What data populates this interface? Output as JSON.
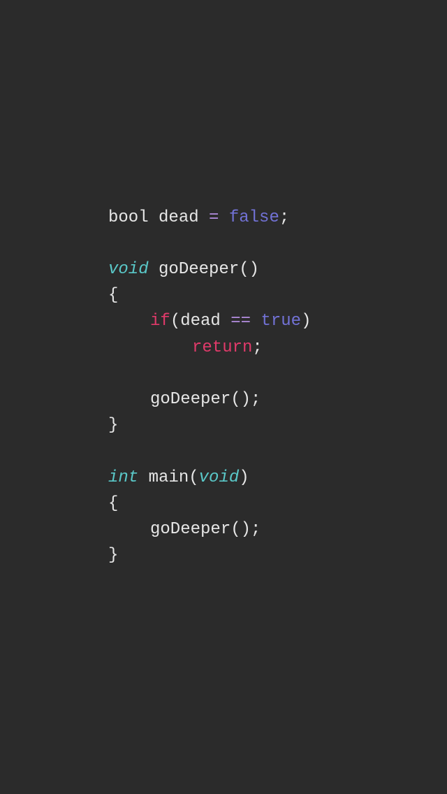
{
  "code": {
    "line1_1": "bool",
    "line1_2": " dead ",
    "line1_3": "=",
    "line1_4": " ",
    "line1_5": "false",
    "line1_6": ";",
    "line2_1": "void",
    "line2_2": " goDeeper",
    "line2_3": "()",
    "line3_1": "{",
    "line4_1": "if",
    "line4_2": "(",
    "line4_3": "dead ",
    "line4_4": "==",
    "line4_5": " ",
    "line4_6": "true",
    "line4_7": ")",
    "line5_1": "return",
    "line5_2": ";",
    "line6_1": "goDeeper",
    "line6_2": "();",
    "line7_1": "}",
    "line8_1": "int",
    "line8_2": " main",
    "line8_3": "(",
    "line8_4": "void",
    "line8_5": ")",
    "line9_1": "{",
    "line10_1": "goDeeper",
    "line10_2": "();",
    "line11_1": "}"
  },
  "colors": {
    "background": "#2b2b2b",
    "foreground": "#e6e6e6",
    "type_italic": "#5ac8c8",
    "operator": "#b48ee0",
    "keyword_value": "#7272d6",
    "control_flow": "#e03a6a"
  }
}
